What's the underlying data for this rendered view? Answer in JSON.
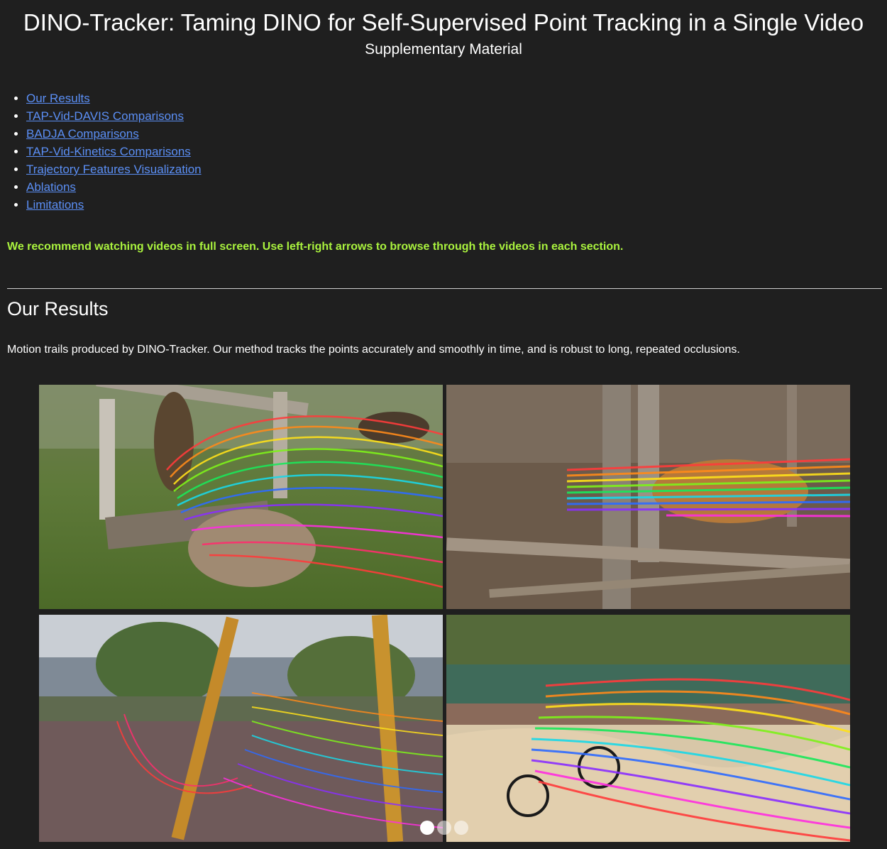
{
  "header": {
    "title": "DINO-Tracker: Taming DINO for Self-Supervised Point Tracking in a Single Video",
    "subtitle": "Supplementary Material"
  },
  "toc": {
    "items": [
      {
        "label": "Our Results"
      },
      {
        "label": "TAP-Vid-DAVIS Comparisons"
      },
      {
        "label": "BADJA Comparisons"
      },
      {
        "label": "TAP-Vid-Kinetics Comparisons"
      },
      {
        "label": "Trajectory Features Visualization"
      },
      {
        "label": "Ablations"
      },
      {
        "label": "Limitations"
      }
    ]
  },
  "notice": {
    "text": "We recommend watching videos in full screen. Use left-right arrows to browse through the videos in each section.",
    "color": "#aaf33e"
  },
  "section": {
    "title": "Our Results",
    "description": "Motion trails produced by DINO-Tracker. Our method tracks the points accurately and smoothly in time, and is robust to long, repeated occlusions."
  },
  "carousel": {
    "videos": [
      {
        "subject": "kangaroo",
        "icon": "video-frame-kangaroo"
      },
      {
        "subject": "tiger",
        "icon": "video-frame-tiger"
      },
      {
        "subject": "child on swing",
        "icon": "video-frame-swing"
      },
      {
        "subject": "bmx rider",
        "icon": "video-frame-bmx"
      }
    ],
    "slide_count": 3,
    "active_slide": 1
  },
  "colors": {
    "background": "#1f1f1f",
    "link": "#5b8ff5",
    "notice": "#aaf33e"
  }
}
